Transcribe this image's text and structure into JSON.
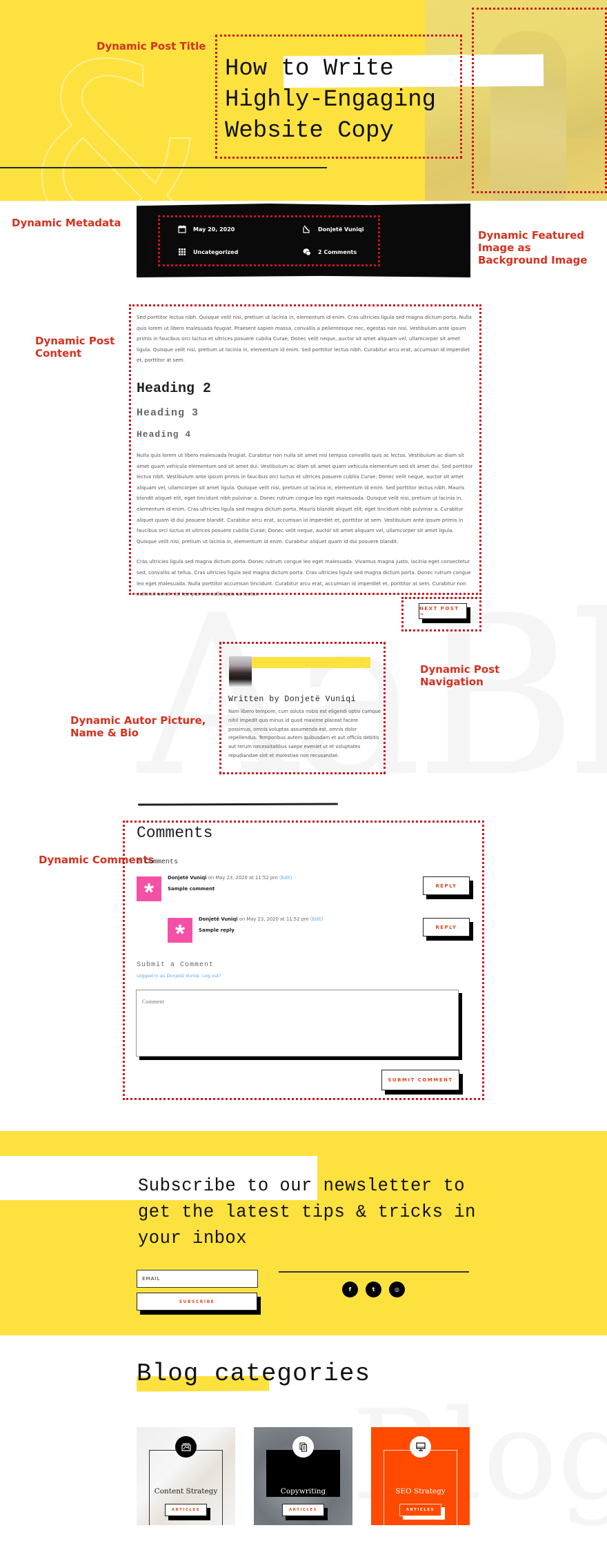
{
  "colors": {
    "brand_yellow": "#fde23f",
    "annotation_red": "#d4311f",
    "accent_orange": "#ff4a00",
    "avatar_pink": "#f451a6",
    "link_blue": "#5aa6e8"
  },
  "annotations": {
    "post_title": "Dynamic Post Title",
    "metadata": "Dynamic Metadata",
    "featured_image": "Dynamic Featured Image as Background Image",
    "post_content": "Dynamic Post Content",
    "post_navigation": "Dynamic Post Navigation",
    "author": "Dynamic Autor Picture, Name & Bio",
    "comments": "Dynamic Comments"
  },
  "hero": {
    "title_line1": "How to Write",
    "title_line2": "Highly-Engaging",
    "title_line3": "Website Copy"
  },
  "metadata": {
    "date": {
      "icon": "calendar-icon",
      "text": "May 20, 2020"
    },
    "author": {
      "icon": "edit-icon",
      "text": "Donjetë Vuniqi"
    },
    "category": {
      "icon": "grid-icon",
      "text": "Uncategorized"
    },
    "comments": {
      "icon": "comments-icon",
      "text": "2 Comments"
    }
  },
  "content": {
    "para1": "Sed porttitor lectus nibh. Quisque velit nisi, pretium ut lacinia in, elementum id enim. Cras ultricies ligula sed magna dictum porta. Nulla quis lorem ut libero malesuada feugiat. Praesent sapien massa, convallis a pellentesque nec, egestas non nisi. Vestibulum ante ipsum primis in faucibus orci luctus et ultrices posuere cubilia Curae; Donec velit neque, auctor sit amet aliquam vel, ullamcorper sit amet ligula. Quisque velit nisi, pretium ut lacinia in, elementum id enim. Sed porttitor lectus nibh. Curabitur arcu erat, accumsan id imperdiet et, porttitor at sem.",
    "heading2": "Heading 2",
    "heading3": "Heading 3",
    "heading4": "Heading 4",
    "para2": "Nulla quis lorem ut libero malesuada feugiat. Curabitur non nulla sit amet nisl tempus convallis quis ac lectus. Vestibulum ac diam sit amet quam vehicula elementum sed sit amet dui. Vestibulum ac diam sit amet quam vehicula elementum sed sit amet dui. Sed porttitor lectus nibh. Vestibulum ante ipsum primis in faucibus orci luctus et ultrices posuere cubilia Curae; Donec velit neque, auctor sit amet aliquam vel, ullamcorper sit amet ligula. Quisque velit nisi, pretium ut lacinia in, elementum id enim. Sed porttitor lectus nibh. Mauris blandit aliquet elit, eget tincidunt nibh pulvinar a. Donec rutrum congue leo eget malesuada. Quisque velit nisi, pretium ut lacinia in, elementum id enim. Cras ultricies ligula sed magna dictum porta. Mauris blandit aliquet elit, eget tincidunt nibh pulvinar a. Curabitur aliquet quam id dui posuere blandit. Curabitur arcu erat, accumsan id imperdiet et, porttitor at sem. Vestibulum ante ipsum primis in faucibus orci luctus et ultrices posuere cubilia Curae; Donec velit neque, auctor sit amet aliquam vel, ullamcorper sit amet ligula. Quisque velit nisi, pretium ut lacinia in, elementum id enim. Curabitur aliquet quam id dui posuere blandit.",
    "para3": "Cras ultricies ligula sed magna dictum porta. Donec rutrum congue leo eget malesuada. Vivamus magna justo, lacinia eget consectetur sed, convallis at tellus. Cras ultricies ligula sed magna dictum porta. Cras ultricies ligula sed magna dictum porta. Donec rutrum congue leo eget malesuada. Nulla porttitor accumsan tincidunt. Curabitur arcu erat, accumsan id imperdiet et, porttitor at sem. Curabitur non nulla sit amet nisl tempus convallis quis ac lectus."
  },
  "navigation": {
    "next_post_label": "NEXT POST →"
  },
  "watermarks": {
    "author_bg": "AaBb",
    "blog_bg": "Blog"
  },
  "author": {
    "name": "Written by Donjetë Vuniqi",
    "bio": "Nam libero tempore, cum soluta nobis est eligendi optio cumque nihil impedit quo minus id quod maxime placeat facere possimus, omnis voluptas assumenda est, omnis dolor repellendus. Temporibus autem quibusdam et aut officiis debitis aut rerum necessitatibus saepe eveniet ut et voluptates repudiandae sint et molestiae non recusandae."
  },
  "comments": {
    "title": "Comments",
    "count": "2 Comments",
    "items": [
      {
        "author": "Donjetë Vuniqi",
        "date": " on May 23, 2020 at 11:52 pm ",
        "edit": "(Edit)",
        "text": "Sample comment",
        "reply": "REPLY",
        "avatar_glyph": "*"
      },
      {
        "author": "Donjetë Vuniqi",
        "date": " on May 23, 2020 at 11:52 pm ",
        "edit": "(Edit)",
        "text": "Sample reply",
        "reply": "REPLY",
        "avatar_glyph": "*"
      }
    ],
    "submit_title": "Submit a Comment",
    "logged_in": "Logged in as Donjetë Vuniqi. Log out?",
    "textarea_placeholder": "Comment",
    "submit_label": "SUBMIT COMMENT"
  },
  "newsletter": {
    "title": "Subscribe to our newsletter to get the latest tips & tricks in your inbox",
    "email_placeholder": "EMAIL",
    "subscribe_label": "SUBSCRIBE",
    "social": [
      {
        "icon": "facebook-icon",
        "glyph": "f"
      },
      {
        "icon": "twitter-icon",
        "glyph": "t"
      },
      {
        "icon": "instagram-icon",
        "glyph": "◎"
      }
    ]
  },
  "blog_categories": {
    "title": "Blog categories",
    "cards": [
      {
        "label": "Content Strategy",
        "button": "ARTICLES",
        "icon": "image-box-icon"
      },
      {
        "label": "Copywriting",
        "button": "ARTICLES",
        "icon": "documents-icon"
      },
      {
        "label": "SEO Strategy",
        "button": "ARTICLES",
        "icon": "monitor-icon"
      }
    ]
  }
}
